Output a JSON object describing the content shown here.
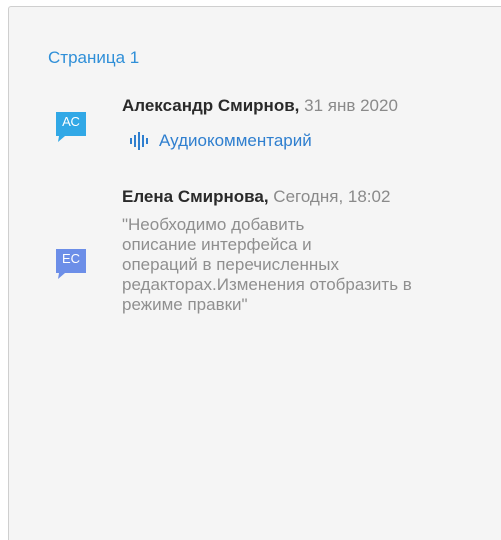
{
  "page_header": "Страница 1",
  "comments": [
    {
      "initials": "АС",
      "avatar_color": "#31a8e6",
      "author": "Александр Смирнов,",
      "date": "31 янв 2020",
      "audio_label": "Аудиокомментарий",
      "audio_icon": "audio-waveform-icon"
    },
    {
      "initials": "ЕС",
      "avatar_color": "#6c8ee8",
      "author": "Елена Смирнова,",
      "date": "Сегодня, 18:02",
      "text": "\"Необходимо добавить\nописание интерфейса и\nопераций в перечисленных\nредакторах.Изменения отобразить в\nрежиме правки\""
    }
  ]
}
